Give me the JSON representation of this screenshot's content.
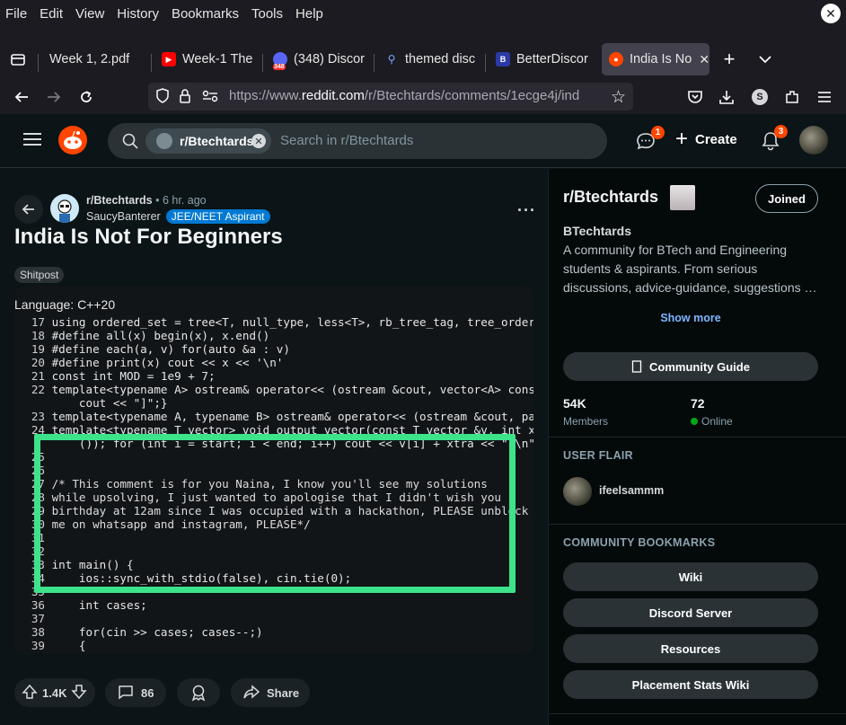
{
  "browser": {
    "menu": [
      "File",
      "Edit",
      "View",
      "History",
      "Bookmarks",
      "Tools",
      "Help"
    ],
    "tabs": [
      {
        "label": "Week 1, 2.pdf",
        "icon": "pdf-icon"
      },
      {
        "label": "Week-1 The",
        "icon": "youtube-icon"
      },
      {
        "label": "(348) Discor",
        "icon": "discord-icon",
        "badge": "348"
      },
      {
        "label": "themed disc",
        "icon": "search-icon"
      },
      {
        "label": "BetterDiscor",
        "icon": "betterdiscord-icon"
      },
      {
        "label": "India Is No",
        "icon": "reddit-icon",
        "active": true
      }
    ],
    "url_prefix": "https://www.",
    "url_main": "reddit.com",
    "url_rest": "/r/Btechtards/comments/1ecge4j/ind",
    "profile_letter": "S"
  },
  "reddit_header": {
    "chip_label": "r/Btechtards",
    "search_placeholder": "Search in r/Btechtards",
    "chat_badge": "1",
    "create_label": "Create",
    "notif_badge": "3"
  },
  "post": {
    "subreddit": "r/Btechtards",
    "time": "• 6 hr. ago",
    "author": "SaucyBanterer",
    "author_flair": "JEE/NEET Aspirant",
    "title": "India Is Not For Beginners",
    "post_flair": "Shitpost",
    "image_header": "Language: C++20",
    "code_lines": [
      {
        "n": "17",
        "t": "using ordered_set = tree<T, null_type, less<T>, rb_tree_tag, tree_order_sta"
      },
      {
        "n": "18",
        "t": "#define all(x) begin(x), x.end()"
      },
      {
        "n": "19",
        "t": "#define each(a, v) for(auto &a : v)"
      },
      {
        "n": "20",
        "t": "#define print(x) cout << x << '\\n'"
      },
      {
        "n": "21",
        "t": "const int MOD = 1e9 + 7;"
      },
      {
        "n": "22",
        "t": "template<typename A> ostream& operator<< (ostream &cout, vector<A> const &v"
      },
      {
        "n": "",
        "t": "    cout << \"]\";}"
      },
      {
        "n": "23",
        "t": "template<typename A, typename B> ostream& operator<< (ostream &cout, pair<A"
      },
      {
        "n": "24",
        "t": "template<typename T_vector> void output_vector(const T_vector &v, int xtra ="
      },
      {
        "n": "",
        "t": "    ()); for (int i = start; i < end; i++) cout << v[i] + xtra << \" \\n\"[i ="
      },
      {
        "n": "25",
        "t": ""
      },
      {
        "n": "26",
        "t": ""
      },
      {
        "n": "27",
        "t": "/* This comment is for you Naina, I know you'll see my solutions"
      },
      {
        "n": "28",
        "t": "while upsolving, I just wanted to apologise that I didn't wish you"
      },
      {
        "n": "29",
        "t": "birthday at 12am since I was occupied with a hackathon, PLEASE unblock"
      },
      {
        "n": "30",
        "t": "me on whatsapp and instagram, PLEASE*/"
      },
      {
        "n": "31",
        "t": ""
      },
      {
        "n": "32",
        "t": ""
      },
      {
        "n": "33",
        "t": "int main() {"
      },
      {
        "n": "34",
        "t": "    ios::sync_with_stdio(false), cin.tie(0);"
      },
      {
        "n": "35",
        "t": ""
      },
      {
        "n": "36",
        "t": "    int cases;"
      },
      {
        "n": "37",
        "t": ""
      },
      {
        "n": "38",
        "t": "    for(cin >> cases; cases--;)"
      },
      {
        "n": "39",
        "t": "    {"
      }
    ],
    "votes": "1.4K",
    "comments": "86",
    "share_label": "Share"
  },
  "sidebar": {
    "name": "r/Btechtards",
    "joined_label": "Joined",
    "display_name": "BTechtards",
    "description": "A community for BTech and Engineering students & aspirants. From serious discussions, advice-guidance, suggestions …",
    "show_more": "Show more",
    "guide_label": "Community Guide",
    "members_count": "54K",
    "members_label": "Members",
    "online_count": "72",
    "online_label": "Online",
    "user_flair_heading": "USER FLAIR",
    "user_flair_name": "ifeelsammm",
    "bookmarks_heading": "COMMUNITY BOOKMARKS",
    "bookmarks": [
      "Wiki",
      "Discord Server",
      "Resources",
      "Placement Stats Wiki"
    ]
  },
  "colors": {
    "accent": "#ff4500",
    "highlight": "#3de38b",
    "flair_blue": "#0079d3"
  }
}
